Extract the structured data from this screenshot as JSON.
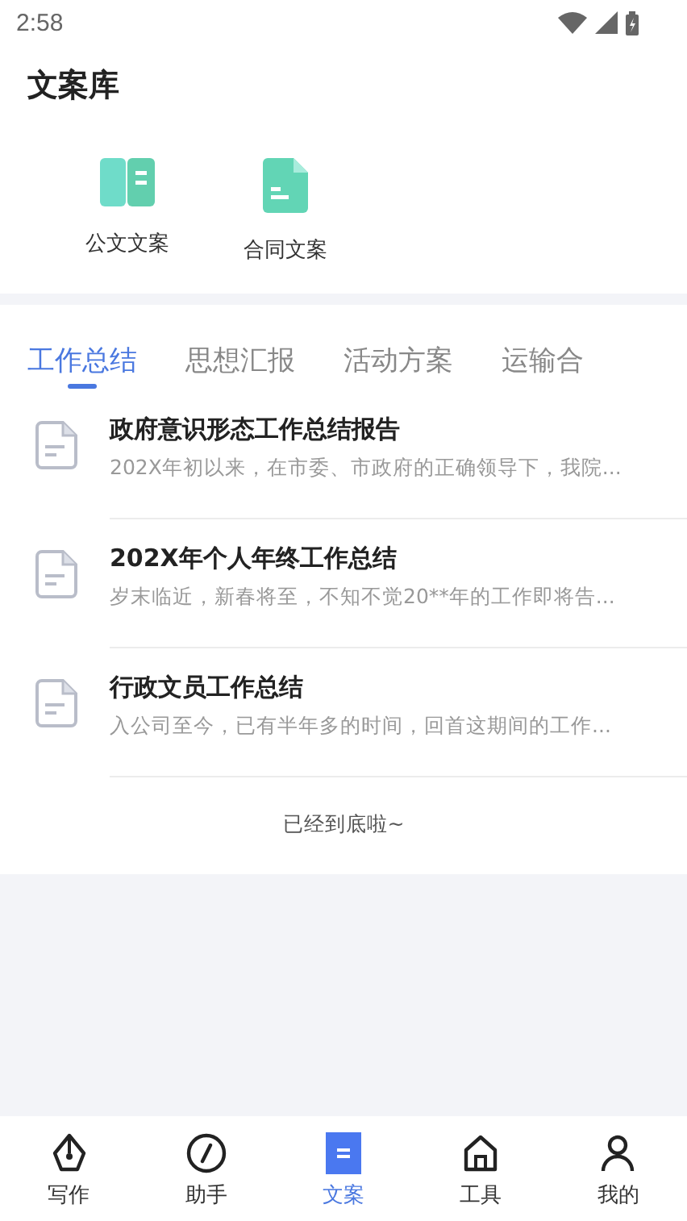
{
  "status_bar": {
    "time": "2:58"
  },
  "page_title": "文案库",
  "categories": [
    {
      "label": "公文文案",
      "kind": "book"
    },
    {
      "label": "合同文案",
      "kind": "doc"
    }
  ],
  "tabs": [
    {
      "label": "工作总结",
      "selected": true
    },
    {
      "label": "思想汇报",
      "selected": false
    },
    {
      "label": "活动方案",
      "selected": false
    },
    {
      "label": "运输合",
      "selected": false
    }
  ],
  "articles": [
    {
      "title": "政府意识形态工作总结报告",
      "excerpt": "202X年初以来，在市委、市政府的正确领导下，我院..."
    },
    {
      "title": "202X年个人年终工作总结",
      "excerpt": "岁末临近，新春将至，不知不觉20**年的工作即将告..."
    },
    {
      "title": "行政文员工作总结",
      "excerpt": "入公司至今，已有半年多的时间，回首这期间的工作..."
    }
  ],
  "list_end": "已经到底啦~",
  "bottom_nav": [
    {
      "label": "写作",
      "kind": "pen",
      "selected": false
    },
    {
      "label": "助手",
      "kind": "compass",
      "selected": false
    },
    {
      "label": "文案",
      "kind": "doc",
      "selected": true
    },
    {
      "label": "工具",
      "kind": "tools",
      "selected": false
    },
    {
      "label": "我的",
      "kind": "user",
      "selected": false
    }
  ]
}
